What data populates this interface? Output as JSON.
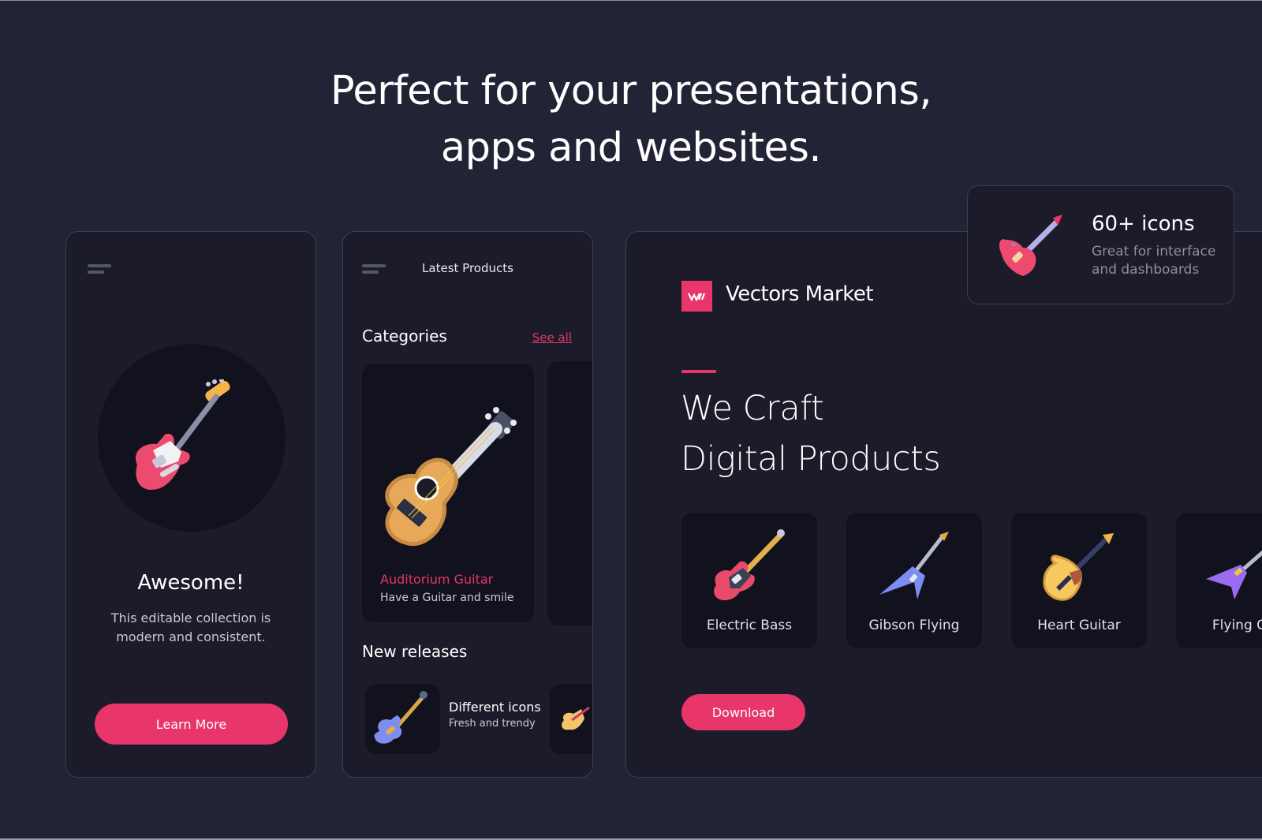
{
  "headline": {
    "line1": "Perfect for your presentations,",
    "line2": "apps and websites."
  },
  "colors": {
    "accent": "#e8356a",
    "background": "#222335",
    "panel": "#1b1b29",
    "card": "#12121e"
  },
  "onboarding": {
    "menu_icon": "hamburger-menu-icon",
    "hero_icon": "electric-guitar-icon",
    "title": "Awesome!",
    "description_line1": "This editable collection is",
    "description_line2": "modern and consistent.",
    "button_label": "Learn More"
  },
  "products_screen": {
    "menu_icon": "hamburger-menu-icon",
    "title": "Latest Products",
    "categories": {
      "title": "Categories",
      "see_all": "See all",
      "items": [
        {
          "name": "Auditorium Guitar",
          "description": "Have a Guitar and smile",
          "icon": "ukulele-icon"
        }
      ]
    },
    "new_releases": {
      "title": "New releases",
      "items": [
        {
          "title": "Different icons",
          "subtitle": "Fresh and trendy",
          "icon": "bass-guitar-icon"
        }
      ]
    }
  },
  "website": {
    "logo_mark": "VM",
    "brand_name": "Vectors Market",
    "heading_line1": "We Craft",
    "heading_line2": "Digital Products",
    "products": [
      {
        "label": "Electric Bass",
        "icon": "electric-bass-icon"
      },
      {
        "label": "Gibson Flying",
        "icon": "gibson-flying-icon"
      },
      {
        "label": "Heart Guitar",
        "icon": "heart-guitar-icon"
      },
      {
        "label": "Flying Gu",
        "icon": "flying-guitar-icon"
      }
    ],
    "download_label": "Download"
  },
  "badge": {
    "title": "60+ icons",
    "description_line1": "Great for interface",
    "description_line2": "and dashboards",
    "icon": "heart-bass-guitar-icon"
  }
}
